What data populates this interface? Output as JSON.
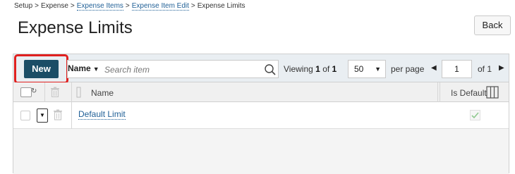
{
  "breadcrumb": {
    "setup": "Setup",
    "expense": "Expense",
    "expense_items": "Expense Items",
    "expense_item_edit": "Expense Item Edit",
    "current": "Expense Limits",
    "separator": ">"
  },
  "page_title": "Expense Limits",
  "back_label": "Back",
  "toolbar": {
    "new_label": "New",
    "field_label": "Name",
    "search_placeholder": "Search item",
    "viewing_label": "Viewing",
    "viewing_from": "1",
    "viewing_of": "of",
    "viewing_total": "1",
    "per_page_value": "50",
    "per_page_label": "per page",
    "page_value": "1",
    "page_of": "of 1"
  },
  "table": {
    "columns": {
      "name": "Name",
      "is_default": "Is Default"
    },
    "rows": [
      {
        "name": "Default Limit",
        "is_default": true
      }
    ]
  },
  "colors": {
    "new_button": "#1b4d66",
    "highlight": "#e0201f",
    "link": "#1f5f96",
    "check_green": "#8fc98f"
  },
  "icons": [
    "search-icon",
    "trash-icon",
    "columns-icon",
    "check-icon",
    "chevron-down-icon",
    "arrow-left-icon",
    "arrow-right-icon"
  ]
}
